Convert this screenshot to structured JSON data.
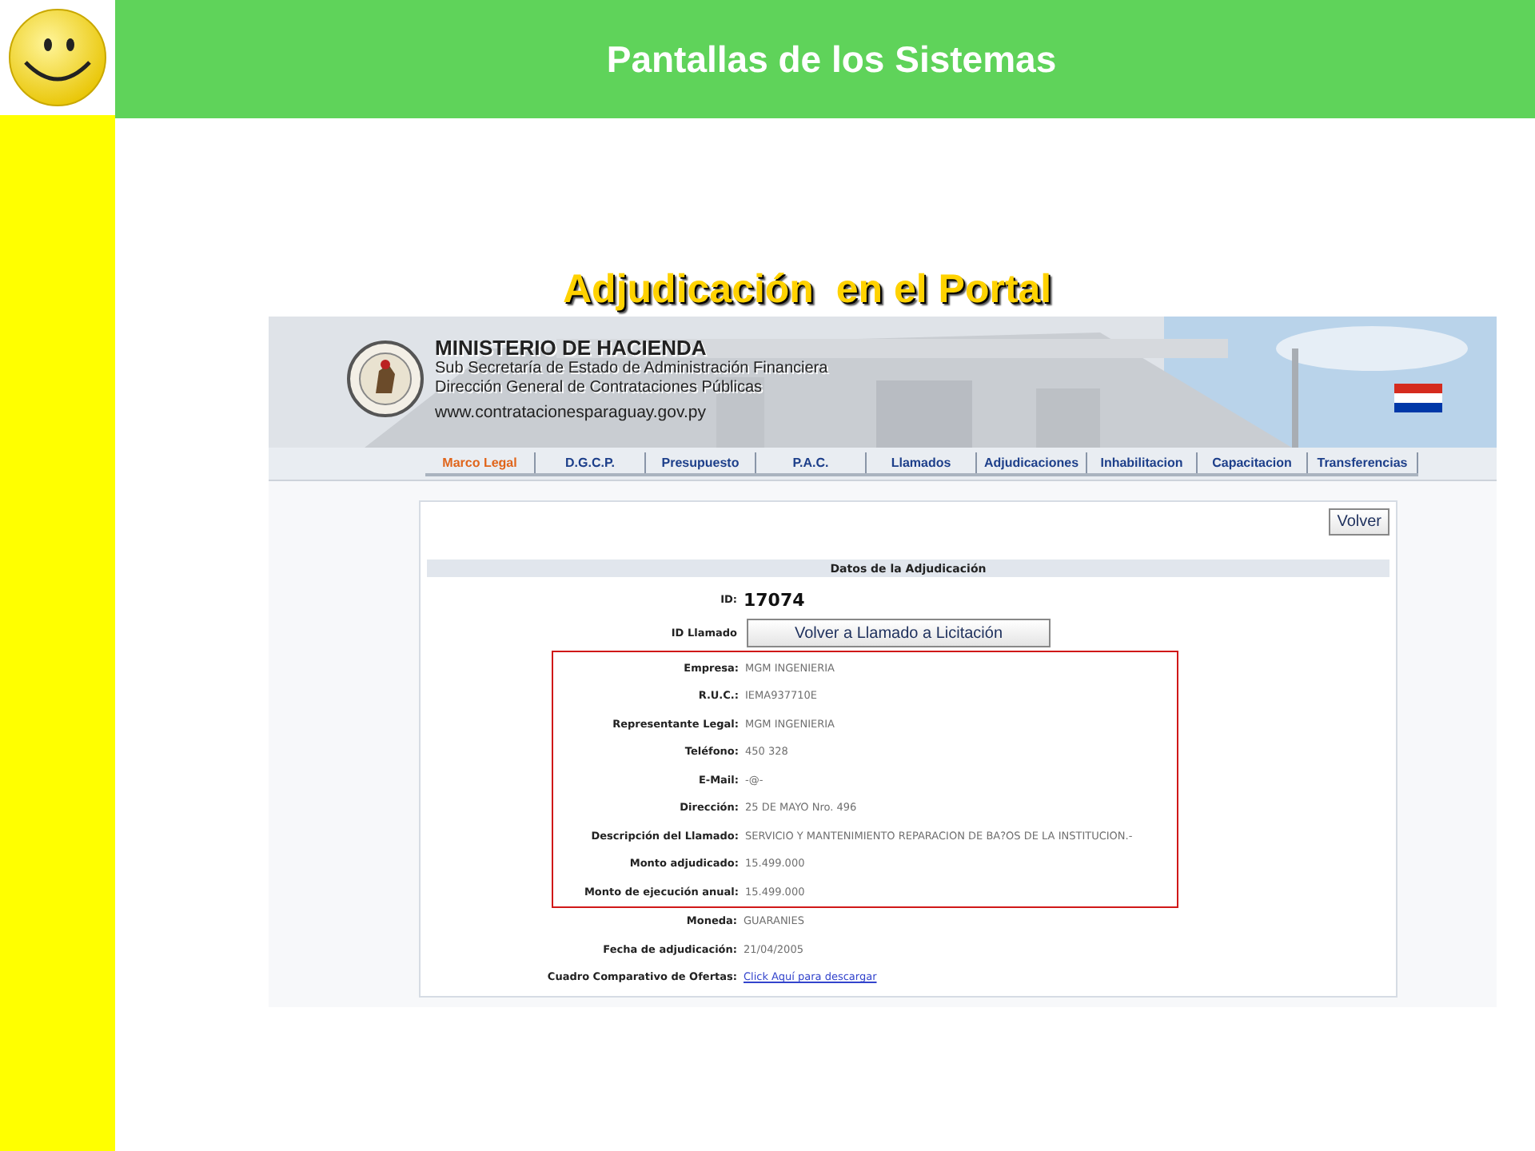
{
  "slide": {
    "title": "Pantallas de los Sistemas",
    "subtitle": "Adjudicación  en el Portal"
  },
  "banner": {
    "kind": "picture",
    "title": "MINISTERIO DE HACIENDA",
    "lines": [
      "Sub Secretaría de Estado de Administración Financiera",
      "Dirección General de Contrataciones Públicas"
    ],
    "url": "www.contratacionesparaguay.gov.py"
  },
  "nav": [
    {
      "label": "Marco Legal",
      "selected": true
    },
    {
      "label": "D.G.C.P.",
      "selected": false
    },
    {
      "label": "Presupuesto",
      "selected": false
    },
    {
      "label": "P.A.C.",
      "selected": false
    },
    {
      "label": "Llamados",
      "selected": false
    },
    {
      "label": "Adjudicaciones",
      "selected": false
    },
    {
      "label": "Inhabilitacion",
      "selected": false
    },
    {
      "label": "Capacitacion",
      "selected": false
    },
    {
      "label": "Transferencias",
      "selected": false
    }
  ],
  "panel": {
    "back_button": "Volver",
    "section_title": "Datos de la Adjudicación",
    "groups": [
      {
        "highlighted": false,
        "fields": [
          {
            "kind": "id",
            "label": "ID:",
            "value": "17074"
          },
          {
            "kind": "button",
            "label": "ID Llamado",
            "value": "Volver a Llamado a Licitación"
          }
        ]
      },
      {
        "highlighted": true,
        "fields": [
          {
            "kind": "text",
            "label": "Empresa:",
            "value": "MGM INGENIERIA"
          },
          {
            "kind": "text",
            "label": "R.U.C.:",
            "value": "IEMA937710E"
          },
          {
            "kind": "text",
            "label": "Representante Legal:",
            "value": "MGM INGENIERIA"
          },
          {
            "kind": "text",
            "label": "Teléfono:",
            "value": "450 328"
          },
          {
            "kind": "text",
            "label": "E-Mail:",
            "value": "-@-"
          },
          {
            "kind": "text",
            "label": "Dirección:",
            "value": "25 DE MAYO Nro. 496"
          },
          {
            "kind": "text",
            "label": "Descripción del Llamado:",
            "value": "SERVICIO Y MANTENIMIENTO REPARACION DE BA?OS DE LA INSTITUCION.-"
          },
          {
            "kind": "text",
            "label": "Monto adjudicado:",
            "value": "15.499.000"
          },
          {
            "kind": "text",
            "label": "Monto de ejecución anual:",
            "value": "15.499.000"
          }
        ]
      },
      {
        "highlighted": false,
        "fields": [
          {
            "kind": "text",
            "label": "Moneda:",
            "value": "GUARANIES"
          },
          {
            "kind": "text",
            "label": "Fecha de adjudicación:",
            "value": "21/04/2005"
          },
          {
            "kind": "link",
            "label": "Cuadro Comparativo de Ofertas:",
            "value": "Click Aquí para descargar"
          }
        ]
      }
    ]
  }
}
